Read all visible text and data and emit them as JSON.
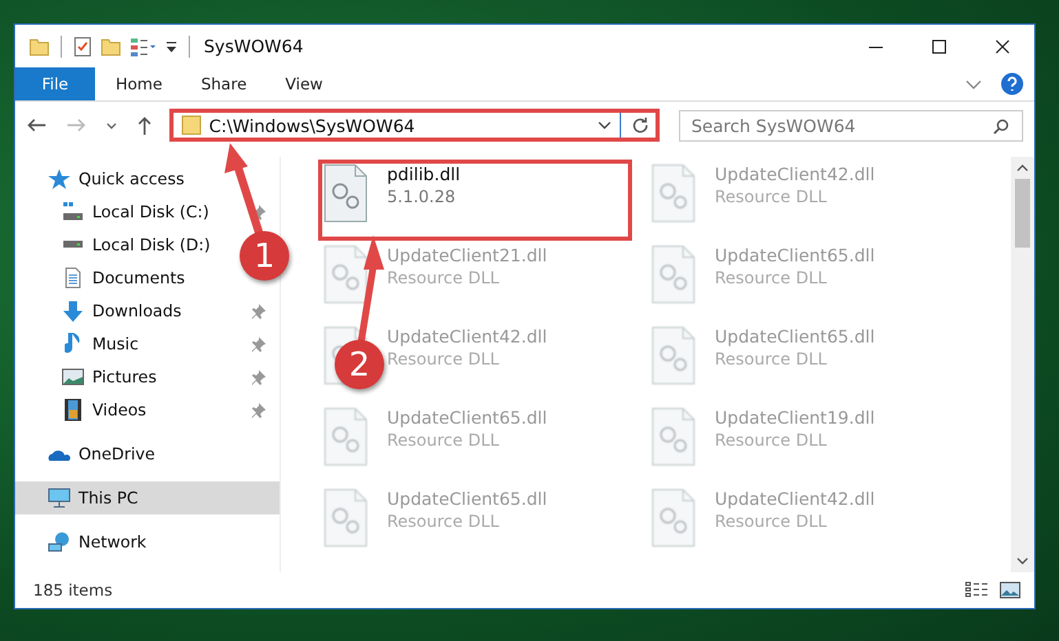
{
  "window": {
    "title": "SysWOW64"
  },
  "ribbon": {
    "tabs": [
      {
        "label": "File",
        "kind": "file",
        "selected": false
      },
      {
        "label": "Home",
        "kind": "tab",
        "selected": false
      },
      {
        "label": "Share",
        "kind": "tab",
        "selected": false
      },
      {
        "label": "View",
        "kind": "tab",
        "selected": false
      }
    ]
  },
  "address_bar": {
    "path": "C:\\Windows\\SysWOW64",
    "highlighted": true
  },
  "search": {
    "placeholder": "Search SysWOW64"
  },
  "sidebar": {
    "items": [
      {
        "label": "Quick access",
        "selected": false,
        "children": [
          {
            "label": "Local Disk (C:)",
            "pinned": true,
            "selected": false
          },
          {
            "label": "Local Disk (D:)",
            "selected": false
          },
          {
            "label": "Documents",
            "selected": false
          },
          {
            "label": "Downloads",
            "pinned": true,
            "selected": false
          },
          {
            "label": "Music",
            "pinned": true,
            "selected": false
          },
          {
            "label": "Pictures",
            "pinned": true,
            "selected": false
          },
          {
            "label": "Videos",
            "pinned": true,
            "selected": false
          }
        ]
      },
      {
        "label": "OneDrive",
        "selected": false
      },
      {
        "label": "This PC",
        "selected": true
      },
      {
        "label": "Network",
        "selected": false
      }
    ]
  },
  "files": [
    {
      "name": "pdilib.dll",
      "detail": "5.1.0.28",
      "blurred": false,
      "highlighted": true
    },
    {
      "name": "UpdateClient42.dll",
      "detail": "Resource DLL",
      "blurred": true,
      "highlighted": false
    },
    {
      "name": "UpdateClient21.dll",
      "detail": "Resource DLL",
      "blurred": true,
      "highlighted": false
    },
    {
      "name": "UpdateClient65.dll",
      "detail": "Resource DLL",
      "blurred": true,
      "highlighted": false
    },
    {
      "name": "UpdateClient42.dll",
      "detail": "Resource DLL",
      "blurred": true,
      "highlighted": false
    },
    {
      "name": "UpdateClient65.dll",
      "detail": "Resource DLL",
      "blurred": true,
      "highlighted": false
    },
    {
      "name": "UpdateClient65.dll",
      "detail": "Resource DLL",
      "blurred": true,
      "highlighted": false
    },
    {
      "name": "UpdateClient19.dll",
      "detail": "Resource DLL",
      "blurred": true,
      "highlighted": false
    },
    {
      "name": "UpdateClient65.dll",
      "detail": "Resource DLL",
      "blurred": true,
      "highlighted": false
    },
    {
      "name": "UpdateClient42.dll",
      "detail": "Resource DLL",
      "blurred": true,
      "highlighted": false
    }
  ],
  "annotations": [
    {
      "number": "1"
    },
    {
      "number": "2"
    }
  ],
  "status_bar": {
    "item_count": "185 items"
  }
}
